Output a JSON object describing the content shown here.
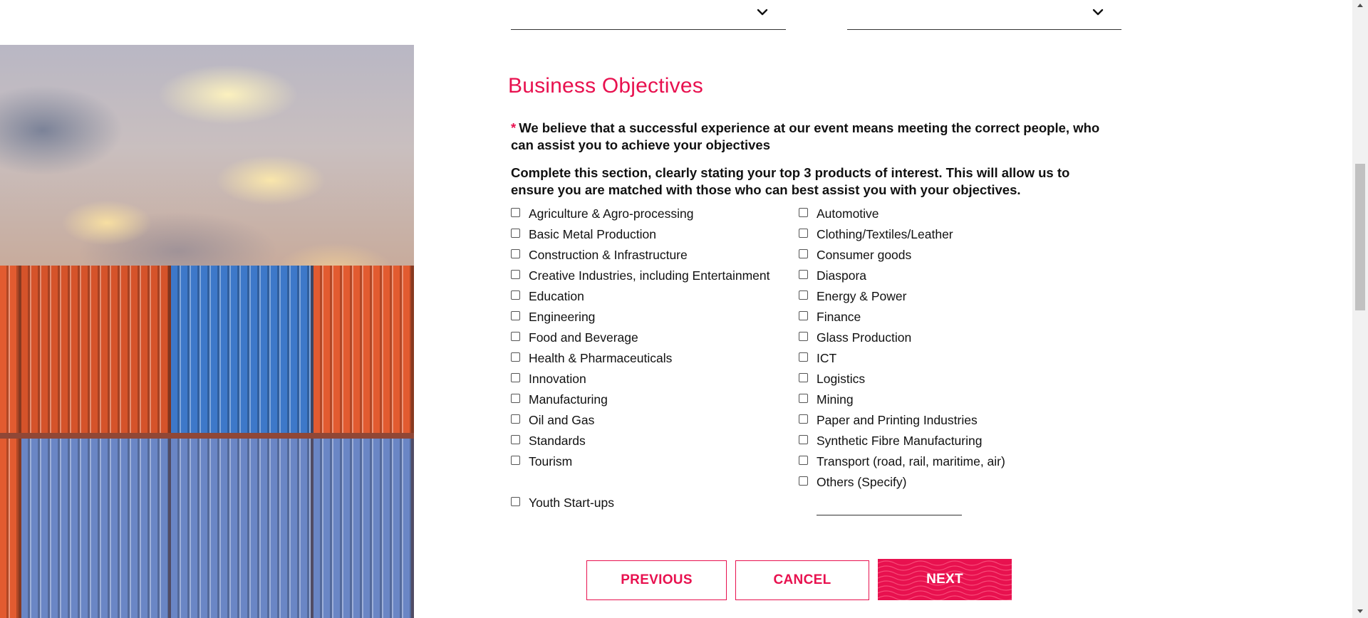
{
  "section": {
    "title": "Business Objectives",
    "required_marker": "*",
    "question": "We believe that a successful experience at our event means meeting the correct people, who can assist you to achieve your objectives",
    "instructions": "Complete this section, clearly stating your top 3 products of interest. This will allow us to ensure you are matched with those who can best assist you with your objectives."
  },
  "options_left": [
    "Agriculture & Agro-processing",
    "Basic Metal Production",
    "Construction & Infrastructure",
    "Creative Industries, including Entertainment",
    "Education",
    "Engineering",
    "Food and Beverage",
    "Health & Pharmaceuticals",
    "Innovation",
    "Manufacturing",
    "Oil and Gas",
    "Standards",
    "Tourism",
    "Youth Start-ups"
  ],
  "options_right": [
    "Automotive",
    "Clothing/Textiles/Leather",
    "Consumer goods",
    "Diaspora",
    "Energy & Power",
    "Finance",
    "Glass Production",
    "ICT",
    "Logistics",
    "Mining",
    "Paper and Printing Industries",
    "Synthetic Fibre Manufacturing",
    "Transport (road, rail, maritime, air)",
    "Others (Specify)"
  ],
  "buttons": {
    "previous": "PREVIOUS",
    "cancel": "CANCEL",
    "next": "NEXT"
  },
  "colors": {
    "accent": "#e8114f",
    "text": "#111111"
  },
  "icons": {
    "select_chevron": "chevron-down-icon",
    "scroll_up": "scroll-up-arrow-icon",
    "scroll_down": "scroll-down-arrow-icon"
  }
}
